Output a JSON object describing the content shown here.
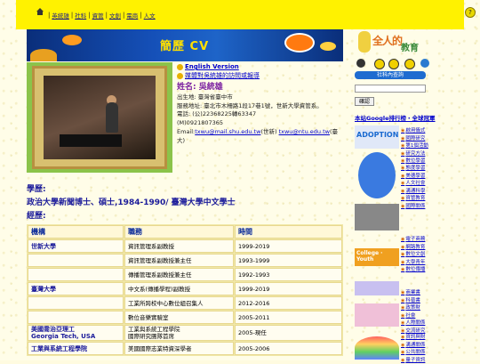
{
  "topnav": {
    "links": [
      "英統雄",
      "社科",
      "資管",
      "文創",
      "電商",
      "人文"
    ]
  },
  "banner": {
    "title": "簡歷 CV"
  },
  "info": {
    "english_link": "English Version",
    "feedback_link": "媒體對吳統雄的訪問或報導",
    "name": "姓名:  吳統雄",
    "born": "出生地:  臺灣省臺中市",
    "address": "服務地址:  臺北市木柵路1段17巷1號，世新大學資管系。",
    "phone": "電話: (公)22368225轉63347",
    "mobile": "(M)0921807365",
    "email_prefix": "Email:",
    "email1": "txwu@mail.shu.edu.tw",
    "email_mid": "(世新)   ",
    "email2": "txwu@ntu.edu.tw",
    "email_suffix": "(臺大)"
  },
  "education": {
    "heading": "學歷:",
    "value": "政治大學新聞博士、碩士,1984-1990/ 臺灣大學中文學士"
  },
  "experience": {
    "heading": "經歷:",
    "columns": [
      "機構",
      "職務",
      "時間"
    ],
    "rows": [
      {
        "org": "世新大學",
        "role": "資訊管理系副教授",
        "time": "1999-2019"
      },
      {
        "org": "",
        "role": "資訊管理系副教授兼主任",
        "time": "1993-1999"
      },
      {
        "org": "",
        "role": "傳播管理系副教授兼主任",
        "time": "1992-1993"
      },
      {
        "org": "臺灣大學",
        "role": "中文系(傳播學程)副教授",
        "time": "1999-2019"
      },
      {
        "org": "",
        "role": "工業所跨校中心數位組召集人",
        "time": "2012-2016"
      },
      {
        "org": "",
        "role": "數位音樂實驗室",
        "time": "2005-2011"
      },
      {
        "org": "美國喬治亞理工\nGeorgia Tech, USA",
        "role": "工業與系統工程學院\n國際研究團隊首席",
        "time": "2005-現任"
      },
      {
        "org": "工業與系統工程學院",
        "role": "美國國際志業特資深學者",
        "time": "2005-2006"
      }
    ]
  },
  "sidebar": {
    "logo_text": "全人的",
    "logo_text2": "教育",
    "search_label": "社科內查詢",
    "search_submit": "確認",
    "google_rank": "本站Google排行榜・全球冠軍",
    "group1": [
      "啟用儀式",
      "國際研究",
      "第1個活動",
      "研究方法",
      "數位學習"
    ],
    "group2": [
      "態度學習",
      "美德學習",
      "人文社會",
      "溝通科學",
      "資管教育",
      "國際關係"
    ],
    "group3": [
      "電子商務",
      "網路教育",
      "數位文創",
      "大學青年",
      "數位傳播"
    ],
    "group4": [
      "商業書",
      "科普書",
      "政策財",
      "社會",
      "人際關係",
      "交流研究"
    ],
    "group5": [
      "資訊與財",
      "溝通關係",
      "公共關係",
      "量子資訊"
    ]
  },
  "colors": {
    "topbar": "#fff200",
    "banner": "#1550b8",
    "heading": "#1a1a9a",
    "name": "#7a1fa0"
  }
}
